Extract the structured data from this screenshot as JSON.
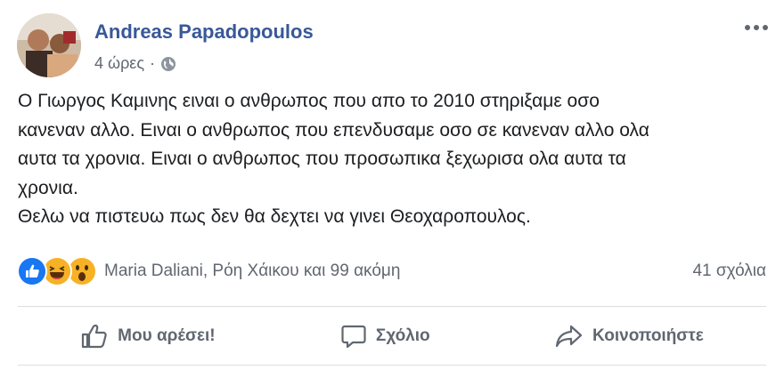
{
  "post": {
    "author": "Andreas Papadopoulos",
    "time": "4 ώρες",
    "separator": "·",
    "privacy_icon": "globe-icon",
    "lines": [
      "Ο Γιωργος Καμινης ειναι ο ανθρωπος που απο το 2010 στηριξαμε οσο",
      "κανεναν αλλο. Ειναι ο ανθρωπος που επενδυσαμε οσο σε κανεναν αλλο ολα",
      "αυτα τα χρονια. Ειναι ο ανθρωπος που προσωπικα ξεχωρισα ολα αυτα τα",
      "χρονια.",
      "Θελω να πιστευω πως δεν θα δεχτει να γινει Θεοχαροπουλος."
    ]
  },
  "reactions": {
    "icons": [
      "like-reaction-icon",
      "haha-reaction-icon",
      "wow-reaction-icon"
    ],
    "names": "Maria Daliani, Ρόη Χάικου και 99 ακόμη",
    "comments": "41 σχόλια"
  },
  "actions": {
    "like": "Μου αρέσει!",
    "comment": "Σχόλιο",
    "share": "Κοινοποιήστε"
  },
  "colors": {
    "author": "#385898",
    "secondary_text": "#616770",
    "like_blue": "#1877f2",
    "reaction_yellow": "#f7b125",
    "divider": "#dadde1"
  }
}
